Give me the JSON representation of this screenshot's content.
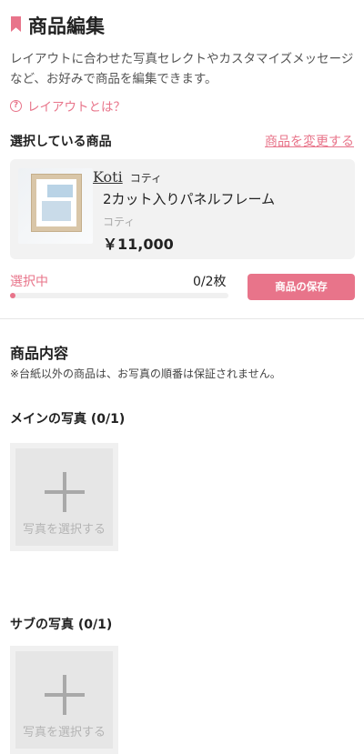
{
  "header": {
    "title": "商品編集",
    "icon": "bookmark-icon",
    "accent_color": "#e8748a"
  },
  "description": "レイアウトに合わせた写真セレクトやカスタマイズメッセージなど、お好みで商品を編集できます。",
  "help_link": {
    "icon": "question-circle-icon",
    "label": "レイアウトとは？"
  },
  "selected_product": {
    "section_label": "選択している商品",
    "change_link": "商品を変更する",
    "brand_logo": "Koti",
    "brand_name": "コティ",
    "name": "2カット入りパネルフレーム",
    "subtitle": "コティ",
    "price": "￥11,000"
  },
  "selection": {
    "label": "選択中",
    "count": "0/2枚",
    "selected": 0,
    "total": 2,
    "save_button": "商品の保存"
  },
  "contents": {
    "title": "商品内容",
    "note": "※台紙以外の商品は、お写真の順番は保証されません。"
  },
  "photo_groups": [
    {
      "title": "メインの写真 (0/1)",
      "slot_label": "写真を選択する",
      "icon": "plus-icon"
    },
    {
      "title": "サブの写真 (0/1)",
      "slot_label": "写真を選択する",
      "icon": "plus-icon"
    }
  ]
}
